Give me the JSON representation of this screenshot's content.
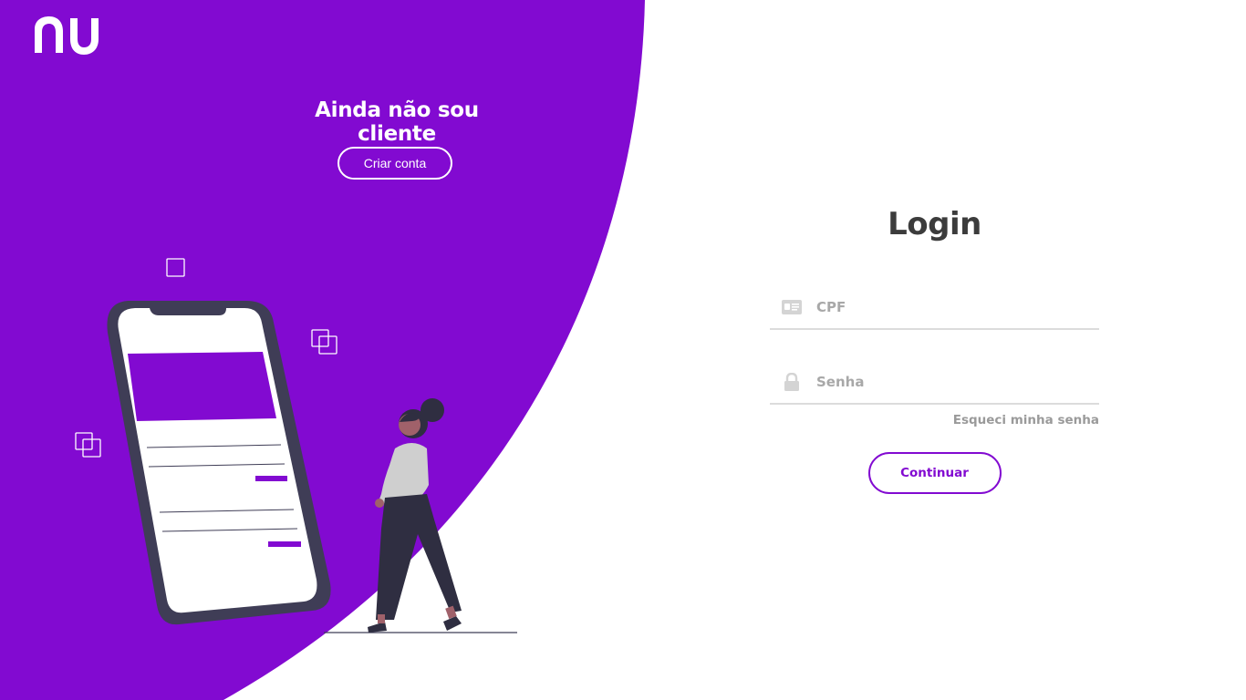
{
  "colors": {
    "brand_purple": "#820ad1",
    "white": "#ffffff",
    "text_dark": "#3c3c3c",
    "placeholder_gray": "#a8a8a8"
  },
  "brand": {
    "logo_name": "nu-logo"
  },
  "promo": {
    "title": "Ainda não sou cliente",
    "create_account_label": "Criar conta"
  },
  "login": {
    "title": "Login",
    "cpf_placeholder": "CPF",
    "cpf_icon": "id-card-icon",
    "password_placeholder": "Senha",
    "password_icon": "lock-icon",
    "forgot_password_label": "Esqueci minha senha",
    "continue_label": "Continuar"
  }
}
